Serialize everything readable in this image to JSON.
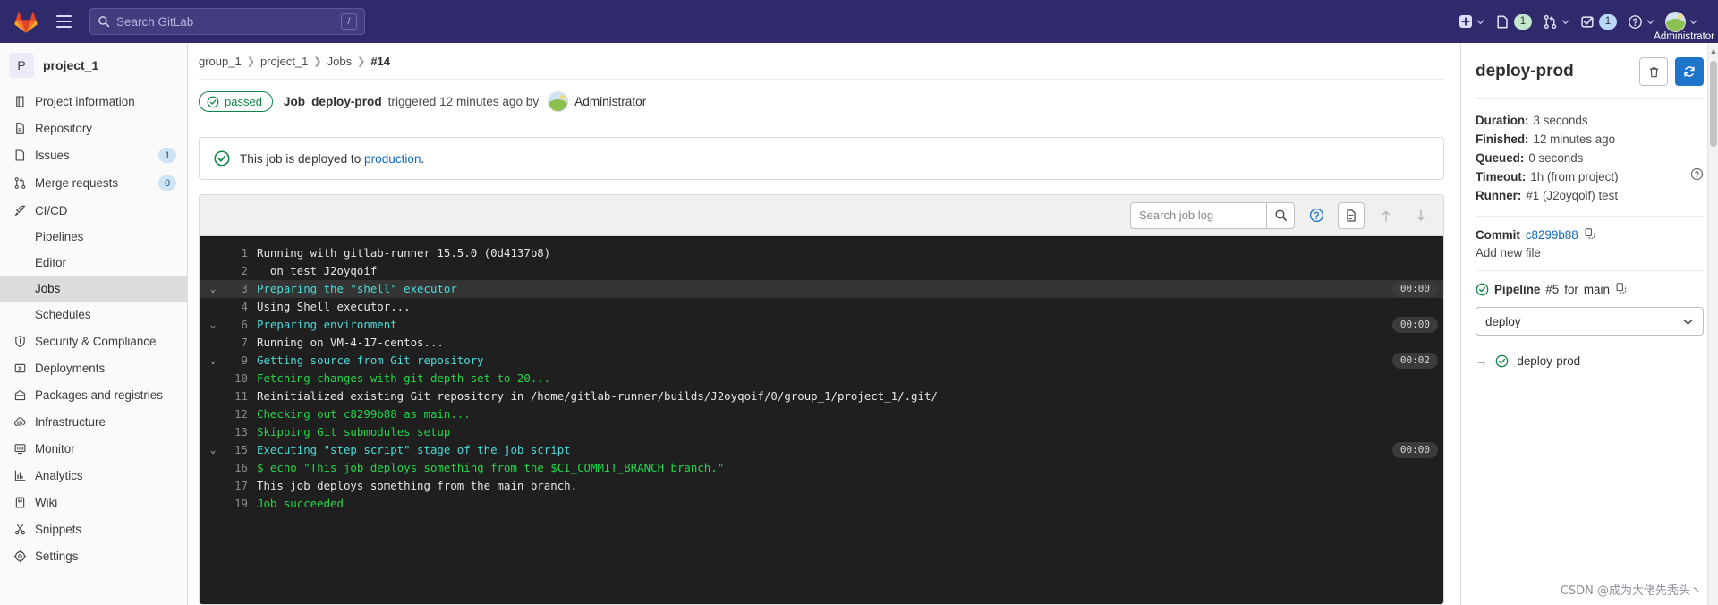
{
  "topnav": {
    "logo_icon": "gitlab-logo-icon",
    "menu_icon": "hamburger-menu-icon",
    "search": {
      "placeholder": "Search GitLab",
      "value": "",
      "shortcut": "/",
      "icon": "search-icon"
    },
    "items": [
      {
        "name": "create-new",
        "icon": "plus-square-icon",
        "caret": true,
        "count": ""
      },
      {
        "name": "issues",
        "icon": "issues-icon",
        "count": "1",
        "count_color": "green",
        "caret": false
      },
      {
        "name": "merge-requests",
        "icon": "merge-request-icon",
        "count": "",
        "caret": true
      },
      {
        "name": "todos",
        "icon": "todo-checkbox-icon",
        "count": "1",
        "count_color": "blue",
        "caret": false
      },
      {
        "name": "help",
        "icon": "question-circle-icon",
        "caret": true,
        "count": ""
      }
    ],
    "user": {
      "name": "Administrator",
      "avatar_icon": "user-avatar-icon",
      "caret": true
    }
  },
  "sidebar": {
    "project": {
      "initial": "P",
      "name": "project_1"
    },
    "items": [
      {
        "label": "Project information",
        "icon": "book-icon",
        "count": "",
        "sub": false,
        "active": false
      },
      {
        "label": "Repository",
        "icon": "document-icon",
        "count": "",
        "sub": false,
        "active": false
      },
      {
        "label": "Issues",
        "icon": "issues-icon",
        "count": "1",
        "sub": false,
        "active": false
      },
      {
        "label": "Merge requests",
        "icon": "merge-request-icon",
        "count": "0",
        "sub": false,
        "active": false
      },
      {
        "label": "CI/CD",
        "icon": "rocket-icon",
        "count": "",
        "sub": false,
        "active": false
      },
      {
        "label": "Pipelines",
        "icon": "",
        "count": "",
        "sub": true,
        "active": false
      },
      {
        "label": "Editor",
        "icon": "",
        "count": "",
        "sub": true,
        "active": false
      },
      {
        "label": "Jobs",
        "icon": "",
        "count": "",
        "sub": true,
        "active": true
      },
      {
        "label": "Schedules",
        "icon": "",
        "count": "",
        "sub": true,
        "active": false
      },
      {
        "label": "Security & Compliance",
        "icon": "shield-icon",
        "count": "",
        "sub": false,
        "active": false
      },
      {
        "label": "Deployments",
        "icon": "deployments-icon",
        "count": "",
        "sub": false,
        "active": false
      },
      {
        "label": "Packages and registries",
        "icon": "package-icon",
        "count": "",
        "sub": false,
        "active": false
      },
      {
        "label": "Infrastructure",
        "icon": "cloud-gear-icon",
        "count": "",
        "sub": false,
        "active": false
      },
      {
        "label": "Monitor",
        "icon": "monitor-icon",
        "count": "",
        "sub": false,
        "active": false
      },
      {
        "label": "Analytics",
        "icon": "chart-bar-icon",
        "count": "",
        "sub": false,
        "active": false
      },
      {
        "label": "Wiki",
        "icon": "book-closed-icon",
        "count": "",
        "sub": false,
        "active": false
      },
      {
        "label": "Snippets",
        "icon": "snippet-scissors-icon",
        "count": "",
        "sub": false,
        "active": false
      },
      {
        "label": "Settings",
        "icon": "gear-icon",
        "count": "",
        "sub": false,
        "active": false
      }
    ]
  },
  "breadcrumb": [
    {
      "label": "group_1",
      "current": false
    },
    {
      "label": "project_1",
      "current": false
    },
    {
      "label": "Jobs",
      "current": false
    },
    {
      "label": "#14",
      "current": true
    }
  ],
  "job_header": {
    "status_label": "passed",
    "status_icon": "status-success-icon",
    "prefix": "Job",
    "job_name": "deploy-prod",
    "triggered_text": "triggered 12 minutes ago by",
    "author": "Administrator",
    "author_avatar_icon": "user-avatar-icon"
  },
  "deploy_alert": {
    "icon": "status-success-icon",
    "text_before": "This job is deployed to",
    "link": "production",
    "text_after": "."
  },
  "log_toolbar": {
    "search_placeholder": "Search job log",
    "search_value": "",
    "search_icon": "search-icon",
    "help_icon": "question-circle-icon",
    "raw_icon": "raw-document-icon",
    "scroll_top_icon": "scroll-to-top-icon",
    "scroll_bottom_icon": "scroll-to-bottom-icon"
  },
  "job_log": {
    "lines": [
      {
        "num": "1",
        "collapsible": false,
        "text": "Running with gitlab-runner 15.5.0 (0d4137b8)",
        "color": "white",
        "duration": ""
      },
      {
        "num": "2",
        "collapsible": false,
        "text": "  on test J2oyqoif",
        "color": "white",
        "duration": ""
      },
      {
        "num": "3",
        "collapsible": true,
        "text": "Preparing the \"shell\" executor",
        "color": "cyan",
        "duration": "00:00",
        "selected": true
      },
      {
        "num": "4",
        "collapsible": false,
        "text": "Using Shell executor...",
        "color": "white",
        "duration": ""
      },
      {
        "num": "6",
        "collapsible": true,
        "text": "Preparing environment",
        "color": "cyan",
        "duration": "00:00"
      },
      {
        "num": "7",
        "collapsible": false,
        "text": "Running on VM-4-17-centos...",
        "color": "white",
        "duration": ""
      },
      {
        "num": "9",
        "collapsible": true,
        "text": "Getting source from Git repository",
        "color": "cyan",
        "duration": "00:02"
      },
      {
        "num": "10",
        "collapsible": false,
        "text": "Fetching changes with git depth set to 20...",
        "color": "green",
        "duration": ""
      },
      {
        "num": "11",
        "collapsible": false,
        "text": "Reinitialized existing Git repository in /home/gitlab-runner/builds/J2oyqoif/0/group_1/project_1/.git/",
        "color": "white",
        "duration": ""
      },
      {
        "num": "12",
        "collapsible": false,
        "text": "Checking out c8299b88 as main...",
        "color": "green",
        "duration": ""
      },
      {
        "num": "13",
        "collapsible": false,
        "text": "Skipping Git submodules setup",
        "color": "green",
        "duration": ""
      },
      {
        "num": "15",
        "collapsible": true,
        "text": "Executing \"step_script\" stage of the job script",
        "color": "cyan",
        "duration": "00:00"
      },
      {
        "num": "16",
        "collapsible": false,
        "text": "$ echo \"This job deploys something from the $CI_COMMIT_BRANCH branch.\"",
        "color": "green",
        "duration": ""
      },
      {
        "num": "17",
        "collapsible": false,
        "text": "This job deploys something from the main branch.",
        "color": "white",
        "duration": ""
      },
      {
        "num": "19",
        "collapsible": false,
        "text": "Job succeeded",
        "color": "green",
        "duration": ""
      }
    ]
  },
  "right_panel": {
    "title": "deploy-prod",
    "erase_icon": "trash-icon",
    "retry_icon": "retry-refresh-icon",
    "meta": [
      {
        "label": "Duration:",
        "value": "3 seconds",
        "help": false
      },
      {
        "label": "Finished:",
        "value": "12 minutes ago",
        "help": false
      },
      {
        "label": "Queued:",
        "value": "0 seconds",
        "help": false
      },
      {
        "label": "Timeout:",
        "value": "1h (from project)",
        "help": true
      },
      {
        "label": "Runner:",
        "value": "#1 (J2oyqoif) test",
        "help": false
      }
    ],
    "commit": {
      "label": "Commit",
      "sha": "c8299b88",
      "copy_icon": "copy-clipboard-icon",
      "message": "Add new file"
    },
    "pipeline": {
      "status_icon": "status-success-icon",
      "label": "Pipeline",
      "number": "#5",
      "for_text": "for",
      "ref": "main",
      "copy_icon": "copy-clipboard-icon",
      "stage_selected": "deploy",
      "stage_caret_icon": "chevron-down-icon"
    },
    "jobs": [
      {
        "arrow_icon": "arrow-right-icon",
        "status_icon": "status-success-icon",
        "name": "deploy-prod"
      }
    ]
  },
  "watermark": "CSDN @成为大佬先秃头丶",
  "colors": {
    "nav_bg": "#2f2a6b",
    "accent_blue": "#1f75cb",
    "link_blue": "#1068bf",
    "success_green": "#108548",
    "log_bg": "#1f1f1f",
    "log_cyan": "#4dd9d9",
    "log_green": "#23d64a"
  }
}
